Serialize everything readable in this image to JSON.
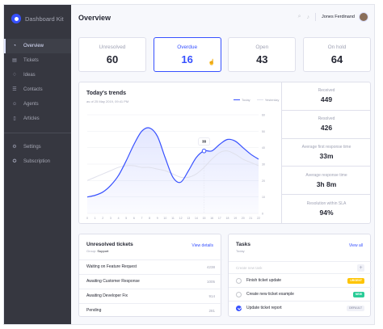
{
  "sidebar": {
    "brand": "Dashboard Kit",
    "items": [
      {
        "label": "Overview",
        "icon": "pie-chart-icon",
        "active": true
      },
      {
        "label": "Tickets",
        "icon": "ticket-icon",
        "active": false
      },
      {
        "label": "Ideas",
        "icon": "lightbulb-icon",
        "active": false
      },
      {
        "label": "Contacts",
        "icon": "contacts-icon",
        "active": false
      },
      {
        "label": "Agents",
        "icon": "agents-icon",
        "active": false
      },
      {
        "label": "Articles",
        "icon": "book-icon",
        "active": false
      }
    ],
    "bottom_items": [
      {
        "label": "Settings",
        "icon": "gear-icon"
      },
      {
        "label": "Subscription",
        "icon": "award-icon"
      }
    ]
  },
  "header": {
    "title": "Overview",
    "user_name": "Jones Ferdinand",
    "search_icon": "search-icon",
    "bell_icon": "bell-icon"
  },
  "kpis": [
    {
      "label": "Unresolved",
      "value": "60",
      "active": false
    },
    {
      "label": "Overdue",
      "value": "16",
      "active": true
    },
    {
      "label": "Open",
      "value": "43",
      "active": false
    },
    {
      "label": "On hold",
      "value": "64",
      "active": false
    }
  ],
  "trends": {
    "title": "Today's trends",
    "subtitle": "as of 25 May 2019, 09:41 PM",
    "legend_today": "Today",
    "legend_yesterday": "Yesterday",
    "tooltip": "38",
    "stats": [
      {
        "label": "Received",
        "value": "449"
      },
      {
        "label": "Resolved",
        "value": "426"
      },
      {
        "label": "Average first response time",
        "value": "33m"
      },
      {
        "label": "Average response time",
        "value": "3h 8m"
      },
      {
        "label": "Resolution within SLA",
        "value": "94%"
      }
    ]
  },
  "chart_data": {
    "type": "line",
    "x": [
      0,
      1,
      2,
      3,
      4,
      5,
      6,
      7,
      8,
      9,
      10,
      11,
      12,
      13,
      14,
      15,
      16,
      17,
      18,
      19,
      20,
      21,
      22
    ],
    "y_ticks": [
      0,
      10,
      20,
      30,
      40,
      50,
      60
    ],
    "ylim": [
      0,
      60
    ],
    "series": [
      {
        "name": "Today",
        "color": "#3751ff",
        "values": [
          10,
          11,
          13,
          17,
          23,
          32,
          42,
          50,
          52,
          47,
          34,
          22,
          19,
          26,
          34,
          38,
          38,
          42,
          45,
          44,
          40,
          36,
          33
        ]
      },
      {
        "name": "Yesterday",
        "color": "#dfe0eb",
        "values": [
          20,
          22,
          24,
          26,
          28,
          29,
          29,
          28,
          28,
          27,
          26,
          24,
          22,
          22,
          24,
          28,
          33,
          37,
          38,
          36,
          33,
          31,
          29
        ]
      }
    ]
  },
  "unresolved": {
    "title": "Unresolved tickets",
    "group_label": "Group:",
    "group_value": "Support",
    "link": "View details",
    "rows": [
      {
        "label": "Waiting on Feature Request",
        "count": "4238"
      },
      {
        "label": "Awaiting Customer Response",
        "count": "1005"
      },
      {
        "label": "Awaiting Developer Fix",
        "count": "914"
      },
      {
        "label": "Pending",
        "count": "281"
      }
    ]
  },
  "tasks": {
    "title": "Tasks",
    "subtitle": "Today",
    "link": "View all",
    "placeholder": "Create new task",
    "items": [
      {
        "label": "Finish ticket update",
        "badge": "Urgent",
        "badge_color": "#fec400",
        "done": false
      },
      {
        "label": "Create new ticket example",
        "badge": "New",
        "badge_color": "#29cc97",
        "done": false
      },
      {
        "label": "Update ticket report",
        "badge": "Default",
        "badge_color": "#f0f1f7",
        "done": true
      }
    ]
  }
}
